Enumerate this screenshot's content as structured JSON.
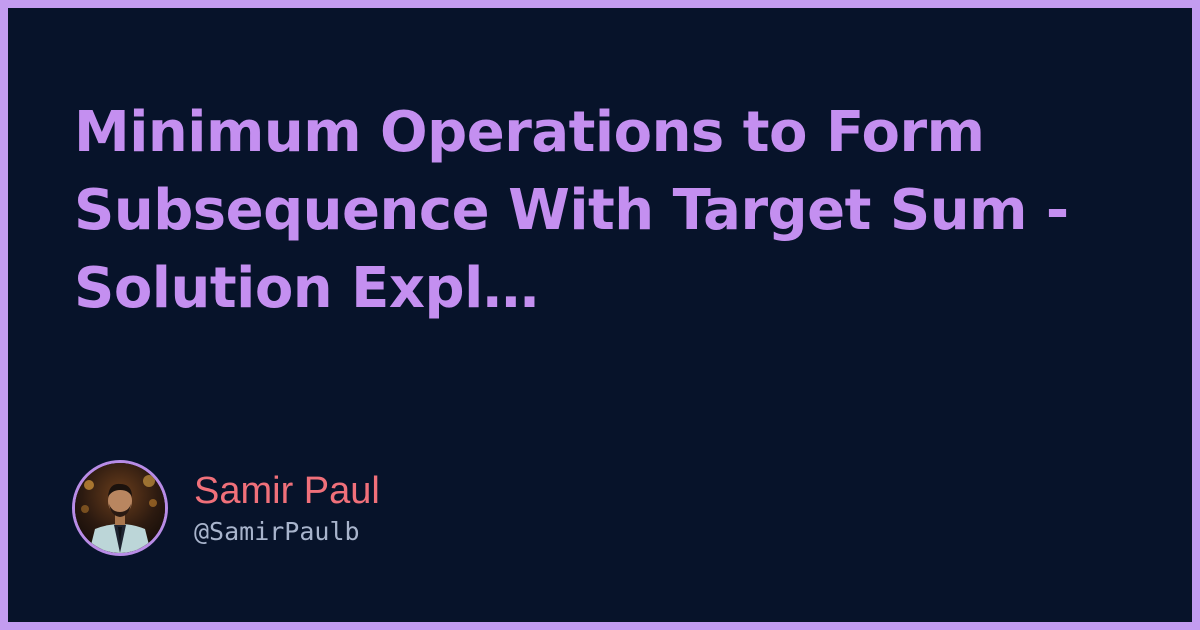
{
  "post": {
    "title": "Minimum Operations to Form Subsequence With Target Sum - Solution Expl…"
  },
  "author": {
    "name": "Samir Paul",
    "handle": "@SamirPaulb"
  },
  "colors": {
    "frame": "#c39cf0",
    "background": "#07132a",
    "title": "#c48ff0",
    "name": "#f0707a",
    "handle": "#a8b4cc"
  }
}
